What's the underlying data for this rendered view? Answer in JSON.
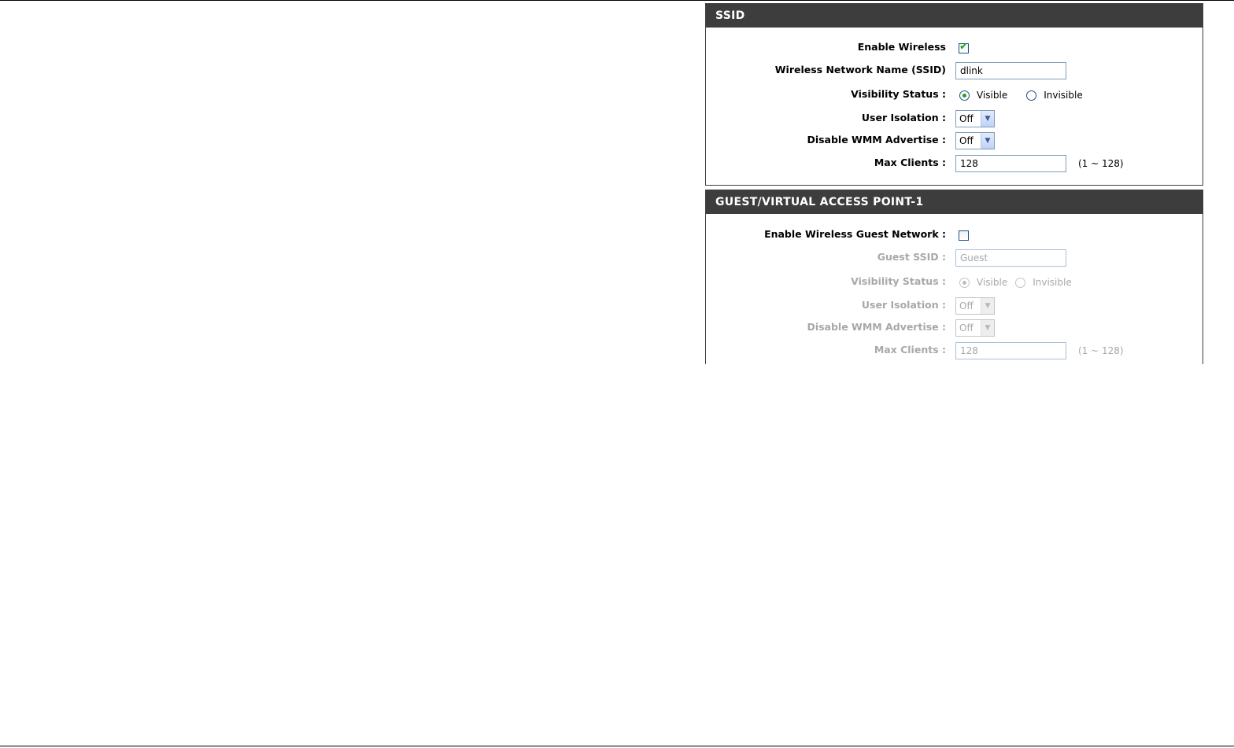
{
  "ssid_panel": {
    "title": "SSID",
    "enable_wireless": {
      "label": "Enable Wireless",
      "checked": true
    },
    "network_name": {
      "label": "Wireless Network Name (SSID)",
      "value": "dlink"
    },
    "visibility": {
      "label": "Visibility Status :",
      "visible_label": "Visible",
      "invisible_label": "Invisible",
      "selected": "Visible"
    },
    "user_isolation": {
      "label": "User Isolation :",
      "value": "Off"
    },
    "disable_wmm": {
      "label": "Disable WMM Advertise :",
      "value": "Off"
    },
    "max_clients": {
      "label": "Max Clients :",
      "value": "128",
      "hint": "(1 ~ 128)"
    }
  },
  "guest_panel": {
    "title": "GUEST/VIRTUAL ACCESS POINT-1",
    "enable_guest": {
      "label": "Enable Wireless Guest Network :",
      "checked": false
    },
    "guest_ssid": {
      "label": "Guest SSID :",
      "value": "Guest"
    },
    "visibility": {
      "label": "Visibility Status :",
      "visible_label": "Visible",
      "invisible_label": "Invisible",
      "selected": "Visible"
    },
    "user_isolation": {
      "label": "User Isolation :",
      "value": "Off"
    },
    "disable_wmm": {
      "label": "Disable WMM Advertise :",
      "value": "Off"
    },
    "max_clients": {
      "label": "Max Clients :",
      "value": "128",
      "hint": "(1 ~ 128)"
    }
  },
  "colors": {
    "header_bg": "#3d3d3d",
    "check_green": "#21a121",
    "disabled_text": "#a8a8a8"
  }
}
